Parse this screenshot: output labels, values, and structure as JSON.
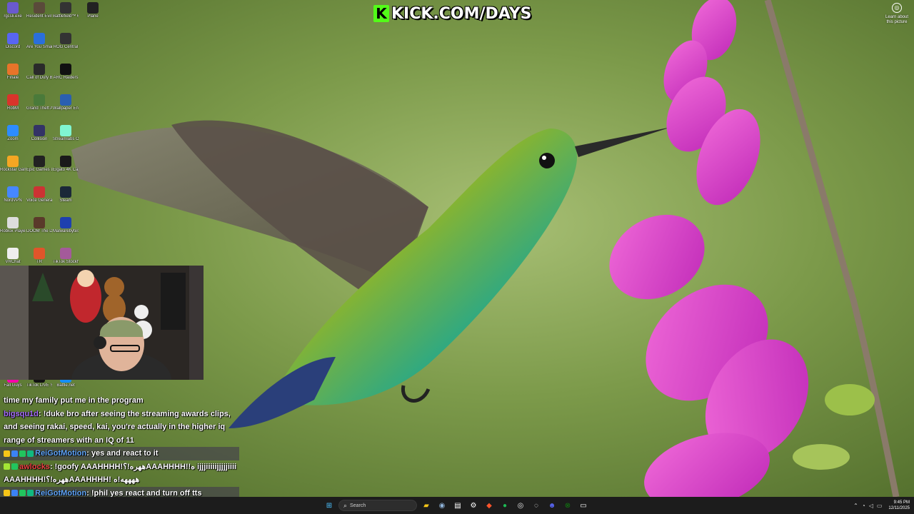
{
  "banner": {
    "logo_letter": "K",
    "text": "KICK.COM/DAYS",
    "accent": "#53fc18"
  },
  "learn_about": {
    "label1": "Learn about",
    "label2": "this picture"
  },
  "desktop_icons": [
    {
      "label": "rgcsli.exe",
      "icon": "app-icon",
      "color": "#6a5acd"
    },
    {
      "label": "Resident Evil 2 Biohazard",
      "icon": "game-icon",
      "color": "#5a4a3a"
    },
    {
      "label": "Battlefield™ 6",
      "icon": "game-icon",
      "color": "#333"
    },
    {
      "label": "Plane",
      "icon": "app-icon",
      "color": "#222"
    },
    {
      "label": "Discord",
      "icon": "discord-icon",
      "color": "#5865f2"
    },
    {
      "label": "Are You Smarter Th...",
      "icon": "game-icon",
      "color": "#2a6fdb"
    },
    {
      "label": "ROG Central",
      "icon": "app-icon",
      "color": "#333"
    },
    {
      "label": "Finalé",
      "icon": "app-icon",
      "color": "#e8742a"
    },
    {
      "label": "Call of Duty Black Ops III",
      "icon": "game-icon",
      "color": "#2a2a2a"
    },
    {
      "label": "ARC Raiders",
      "icon": "game-icon",
      "color": "#111"
    },
    {
      "label": "RobM",
      "icon": "app-icon",
      "color": "#d9342b"
    },
    {
      "label": "Grand Theft Auto V",
      "icon": "game-icon",
      "color": "#4a7a3a"
    },
    {
      "label": "Wallpaper Engine",
      "icon": "app-icon",
      "color": "#2a5fb0"
    },
    {
      "label": "Zoom",
      "icon": "zoom-icon",
      "color": "#2d8cff"
    },
    {
      "label": "Collision",
      "icon": "app-icon",
      "color": "#336"
    },
    {
      "label": "Streamlabs OBS",
      "icon": "streamlabs-icon",
      "color": "#80f5d2"
    },
    {
      "label": "Rockstar Games La...",
      "icon": "rockstar-icon",
      "color": "#f5a623"
    },
    {
      "label": "Epic Games Launcher",
      "icon": "epic-icon",
      "color": "#222"
    },
    {
      "label": "Elgato 4K Capture",
      "icon": "app-icon",
      "color": "#1a1a1a"
    },
    {
      "label": "NordVPN",
      "icon": "nordvpn-icon",
      "color": "#4687ff"
    },
    {
      "label": "Voice Generator",
      "icon": "app-icon",
      "color": "#c33"
    },
    {
      "label": "Steam",
      "icon": "steam-icon",
      "color": "#1b2838"
    },
    {
      "label": "Roblox Player",
      "icon": "roblox-icon",
      "color": "#ddd"
    },
    {
      "label": "DOOM The Dark Ages",
      "icon": "game-icon",
      "color": "#5a3a2a"
    },
    {
      "label": "Malwarebytes",
      "icon": "malwarebytes-icon",
      "color": "#1e40af"
    },
    {
      "label": "VRChat",
      "icon": "vrchat-icon",
      "color": "#eee"
    },
    {
      "label": "TR",
      "icon": "app-icon",
      "color": "#e0552a"
    },
    {
      "label": "TikTok Stockhou...",
      "icon": "app-icon",
      "color": "#a45a9a"
    },
    {
      "label": "Fall Guys",
      "icon": "game-icon",
      "color": "#f0a"
    },
    {
      "label": "TikTok LIVE Studio",
      "icon": "tiktok-icon",
      "color": "#111"
    },
    {
      "label": "Battle.net",
      "icon": "battlenet-icon",
      "color": "#148eff"
    }
  ],
  "chat": [
    {
      "user": "",
      "text": "time my family put me in the program",
      "user_color": "#ffffff",
      "highlight": false,
      "badges": []
    },
    {
      "user": "bigsqu1d",
      "text": ": !duke bro after seeing the streaming awards clips, and seeing rakai, speed, kai, you're actually in the higher iq range of streamers with an IQ of 11",
      "user_color": "#a970ff",
      "highlight": false,
      "badges": []
    },
    {
      "user": "ReiGotMotion",
      "text": ": yes and react to it",
      "user_color": "#60a5fa",
      "highlight": true,
      "badges": [
        "#f5c518",
        "#3b82f6",
        "#22c55e",
        "#10b981"
      ]
    },
    {
      "user": "awlocks",
      "text": ": !goofy AAAHHHH!ههره!؟AAAHHHH!!ه ijjjiiiiijjjjjiiii AAAHHHH!ههره!؟AAAHHHH! ههههه!ه",
      "user_color": "#ef4444",
      "highlight": false,
      "badges": [
        "#a3e635",
        "#22c55e"
      ]
    },
    {
      "user": "ReiGotMotion",
      "text": ": !phil yes react and turn off tts",
      "user_color": "#60a5fa",
      "highlight": true,
      "badges": [
        "#f5c518",
        "#3b82f6",
        "#22c55e",
        "#10b981"
      ]
    }
  ],
  "taskbar": {
    "search_placeholder": "Search",
    "apps": [
      "windows-icon",
      "search-icon",
      "file-explorer-icon",
      "steam-icon",
      "notepad-icon",
      "settings-icon",
      "brave-icon",
      "spotify-icon",
      "chrome-icon",
      "obs-icon",
      "discord-icon",
      "xbox-icon",
      "terminal-icon"
    ],
    "time": "9:45 PM",
    "date": "12/11/2025"
  }
}
